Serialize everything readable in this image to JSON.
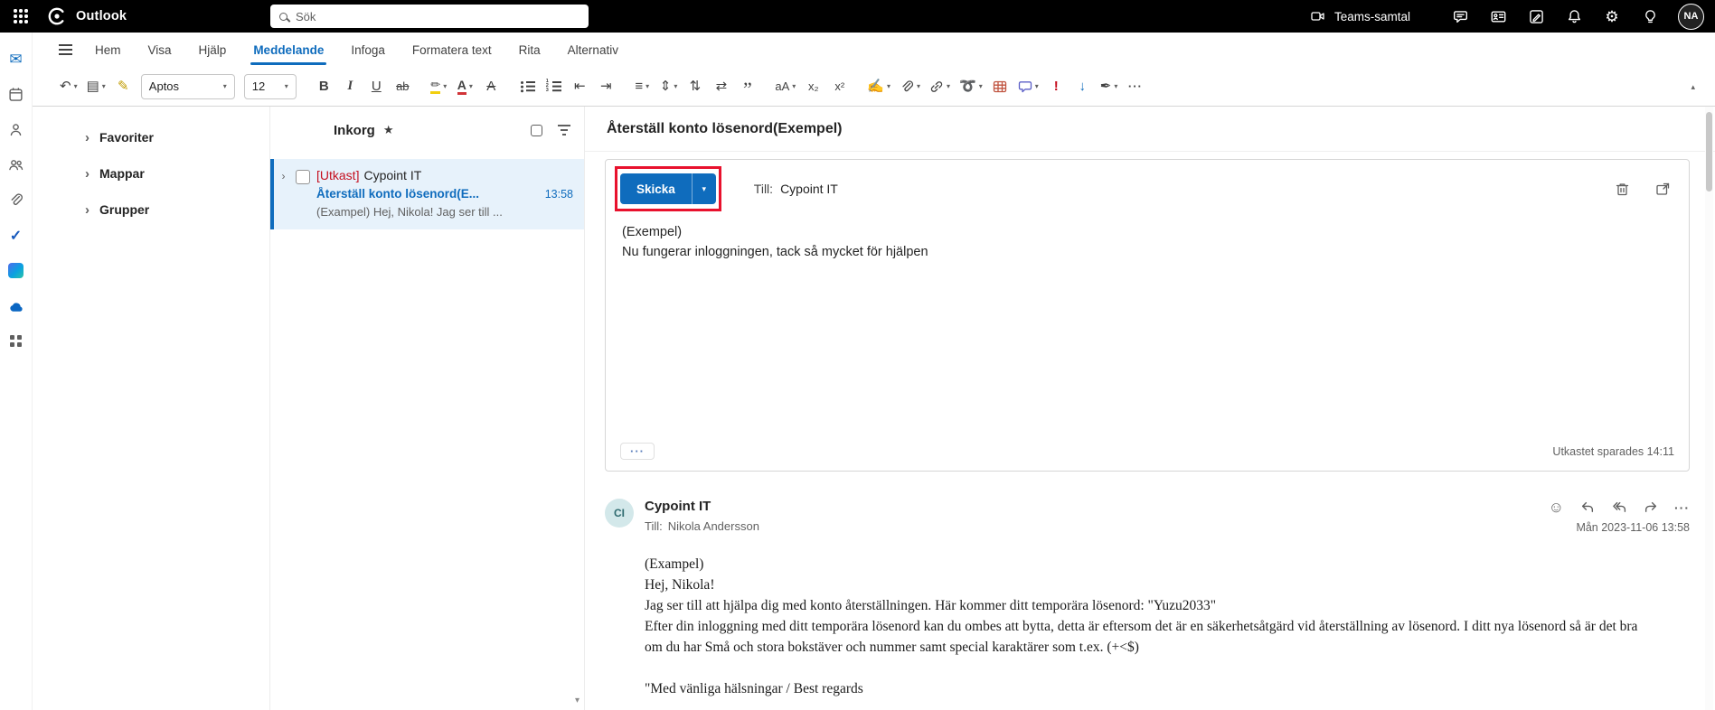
{
  "icons": {
    "chevron_down": "▾",
    "chevron_right": "›",
    "undo": "↶",
    "paste": "▤",
    "format_painter": "✎",
    "bold": "B",
    "italic": "I",
    "underline": "U",
    "strikethrough": "ab",
    "highlight": "✏",
    "font_color": "A",
    "clear_formatting": "A",
    "outdent": "⇤",
    "indent": "⇥",
    "align": "≡",
    "line_spacing": "⇕",
    "sort": "⇅",
    "direction": "⇄",
    "quote": "”",
    "change_case": "aA",
    "subscript": "x₂",
    "superscript": "x²",
    "styles": "✍",
    "loop": "➰",
    "important": "!",
    "low_importance": "↓",
    "signature": "✒",
    "more": "···",
    "collapse": "▴",
    "smiley": "☺",
    "gear": "⚙",
    "star": "★",
    "check": "✓",
    "envelope": "✉",
    "scroll_down": "▾"
  },
  "topbar": {
    "app_name": "Outlook",
    "search_placeholder": "Sök",
    "teams_call_label": "Teams-samtal",
    "avatar_initials": "NA"
  },
  "ribbon": {
    "tabs": [
      "Hem",
      "Visa",
      "Hjälp",
      "Meddelande",
      "Infoga",
      "Formatera text",
      "Rita",
      "Alternativ"
    ],
    "font_name": "Aptos",
    "font_size": "12"
  },
  "sidebar": {
    "folders": [
      "Favoriter",
      "Mappar",
      "Grupper"
    ]
  },
  "message_list": {
    "title": "Inkorg",
    "item": {
      "draft_prefix": "[Utkast]",
      "sender": "Cypoint IT",
      "subject": "Återställ konto lösenord(E...",
      "time": "13:58",
      "preview": "(Exampel) Hej, Nikola! Jag ser till ..."
    }
  },
  "reading_pane": {
    "subject": "Återställ konto lösenord(Exempel)",
    "compose": {
      "send_label": "Skicka",
      "to_label": "Till:",
      "to_value": "Cypoint IT",
      "body_line1": "(Exempel)",
      "body_line2": "Nu fungerar inloggningen, tack så mycket för hjälpen",
      "saved_status": "Utkastet sparades 14:11"
    },
    "original": {
      "avatar_initials": "CI",
      "sender": "Cypoint IT",
      "to_label": "Till:",
      "to_value": "Nikola Andersson",
      "date": "Mån 2023-11-06 13:58",
      "body": {
        "p1": "(Exampel)",
        "p2": "Hej, Nikola!",
        "p3": "Jag ser till att hjälpa dig med konto återställningen. Här kommer ditt temporära lösenord: \"Yuzu2033\"",
        "p4": "Efter din inloggning med ditt temporära lösenord kan du ombes att bytta, detta är eftersom det är en säkerhetsåtgärd vid återställning av lösenord. I ditt nya lösenord så är det bra om du har Små och stora bokstäver och nummer samt special karaktärer som t.ex. (+<$)",
        "p5": "\"Med vänliga hälsningar / Best regards"
      }
    }
  },
  "colors": {
    "accent": "#0f6cbd",
    "annotation_red": "#e8112d",
    "draft_red": "#c50f1f",
    "selection_bg": "#e7f2fb",
    "topbar_bg": "#000000"
  }
}
